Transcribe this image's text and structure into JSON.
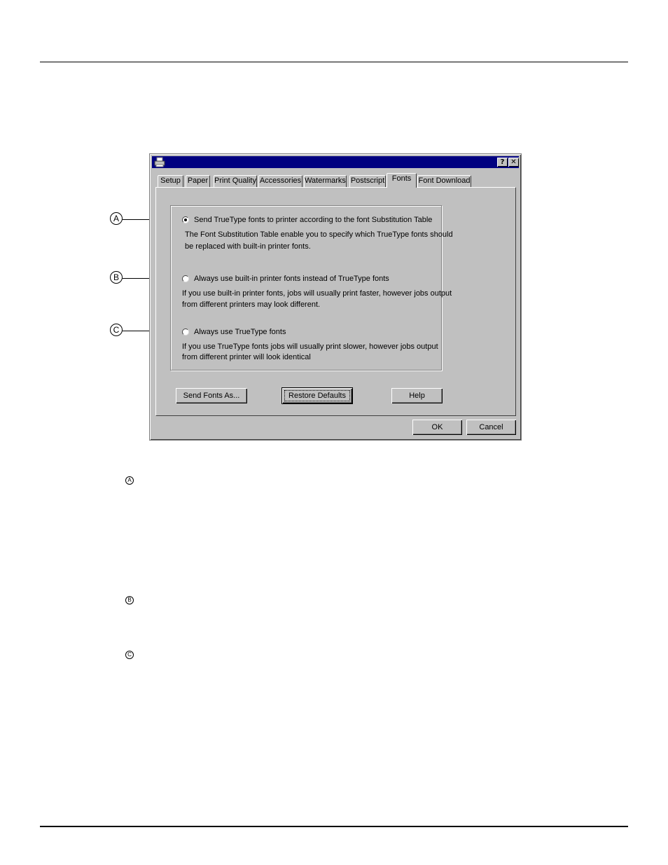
{
  "dialog": {
    "title_buttons": {
      "help": "?",
      "close": "✕"
    },
    "icon": "printer-icon",
    "tabs": [
      {
        "label": "Setup"
      },
      {
        "label": "Paper"
      },
      {
        "label": "Print Quality"
      },
      {
        "label": "Accessories"
      },
      {
        "label": "Watermarks"
      },
      {
        "label": "Postscript"
      },
      {
        "label": "Fonts",
        "active": true
      },
      {
        "label": "Font Download"
      }
    ],
    "options": [
      {
        "label": "Send TrueType fonts to printer according to the font Substitution Table",
        "selected": true,
        "description": [
          "The Font Substitution Table enable you to specify which TrueType fonts should",
          "be replaced with built-in printer fonts."
        ]
      },
      {
        "label": "Always use built-in printer fonts instead of TrueType fonts",
        "selected": false,
        "description": [
          "If you use built-in printer fonts, jobs will usually print faster, however jobs output",
          "from different printers may look different."
        ]
      },
      {
        "label": "Always use TrueType fonts",
        "selected": false,
        "description": [
          "If you use TrueType fonts jobs will usually print slower, however jobs output",
          "from different printer will look identical"
        ]
      }
    ],
    "buttons": {
      "send_fonts_as": "Send Fonts As...",
      "restore_defaults": "Restore Defaults",
      "help": "Help",
      "ok": "OK",
      "cancel": "Cancel"
    }
  },
  "callouts": {
    "a": "A",
    "b": "B",
    "c": "C"
  }
}
